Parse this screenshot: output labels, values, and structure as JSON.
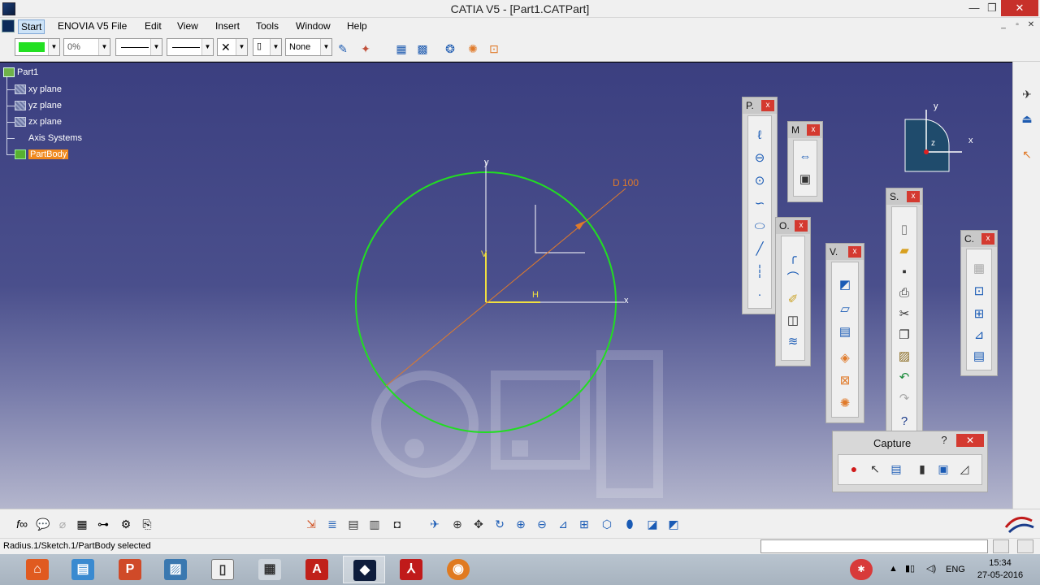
{
  "window": {
    "title": "CATIA V5 - [Part1.CATPart]",
    "controls": {
      "minimize": "—",
      "maximize": "❐",
      "close": "✕"
    }
  },
  "menubar": {
    "items": [
      {
        "label": "Start"
      },
      {
        "label": "ENOVIA V5"
      },
      {
        "label": "File"
      },
      {
        "label": "Edit"
      },
      {
        "label": "View"
      },
      {
        "label": "Insert"
      },
      {
        "label": "Tools"
      },
      {
        "label": "Window"
      },
      {
        "label": "Help"
      }
    ],
    "doc_controls": [
      "_",
      "▫",
      "✕"
    ]
  },
  "toolbar": {
    "color_swatch": "#22e022",
    "transparency": "0%",
    "line_cap": "✕",
    "line_layer": "None"
  },
  "tree": {
    "root": "Part1",
    "items": [
      {
        "label": "xy plane"
      },
      {
        "label": "yz plane"
      },
      {
        "label": "zx plane"
      },
      {
        "label": "Axis Systems"
      },
      {
        "label": "PartBody"
      }
    ]
  },
  "sketch": {
    "dimension_label": "D 100",
    "axis_x": "x",
    "axis_y": "y",
    "h_label": "H",
    "v_label": "V",
    "circle_color": "#22dd22",
    "dimension_color": "#e07a2a",
    "axis_color": "#f0e040"
  },
  "compass": {
    "x": "x",
    "y": "y",
    "z": "z"
  },
  "floating_toolbars": [
    {
      "title": "P."
    },
    {
      "title": "M"
    },
    {
      "title": "O."
    },
    {
      "title": "V."
    },
    {
      "title": "S."
    },
    {
      "title": "C."
    }
  ],
  "capture": {
    "title": "Capture",
    "help": "?",
    "close": "✕"
  },
  "statusbar": {
    "message": "Radius.1/Sketch.1/PartBody selected"
  },
  "taskbar": {
    "language": "ENG",
    "time": "15:34",
    "date": "27-05-2016"
  }
}
